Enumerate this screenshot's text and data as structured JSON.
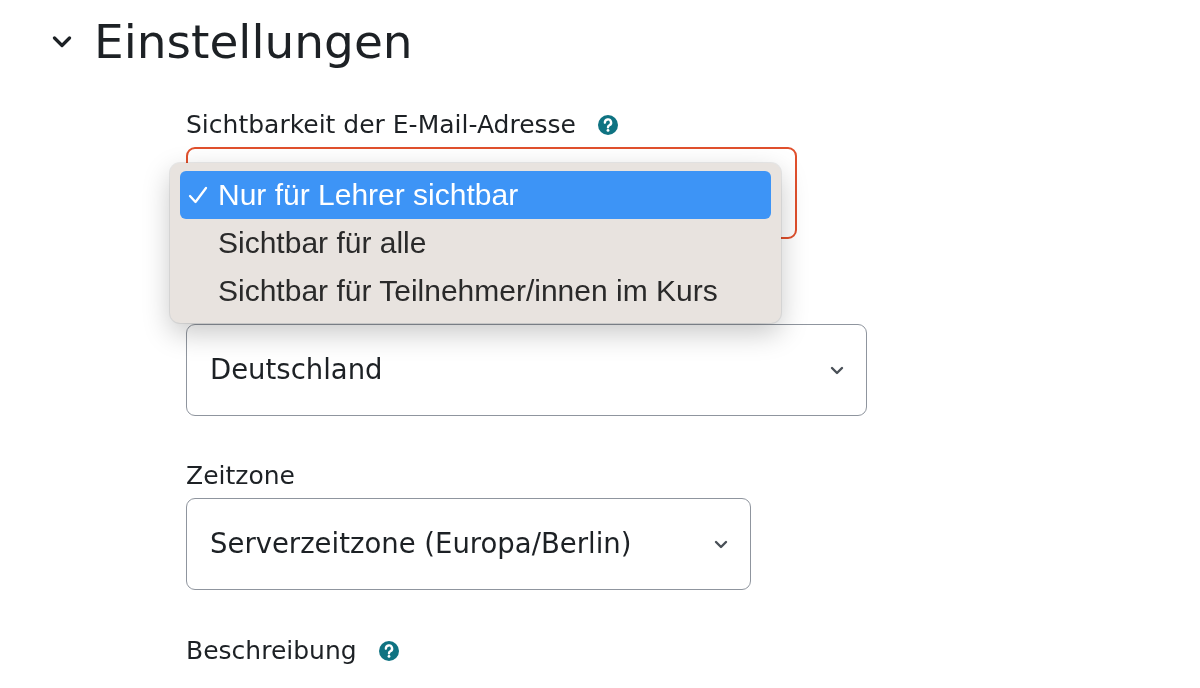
{
  "section": {
    "title": "Einstellungen",
    "expanded": true
  },
  "fields": [
    {
      "kind": "select",
      "label": "Sichtbarkeit der E-Mail-Adresse",
      "help": true,
      "focused": true,
      "open": true,
      "options": [
        {
          "label": "Nur für Lehrer sichtbar",
          "selected": true
        },
        {
          "label": "Sichtbar für alle",
          "selected": false
        },
        {
          "label": "Sichtbar für Teilnehmer/innen im Kurs",
          "selected": false
        }
      ]
    },
    {
      "kind": "select",
      "value": "Deutschland",
      "focused": false,
      "open": false
    },
    {
      "kind": "select",
      "label": "Zeitzone",
      "help": false,
      "value": "Serverzeitzone (Europa/Berlin)",
      "focused": false,
      "open": false
    },
    {
      "kind": "label",
      "label": "Beschreibung",
      "help": true
    }
  ]
}
